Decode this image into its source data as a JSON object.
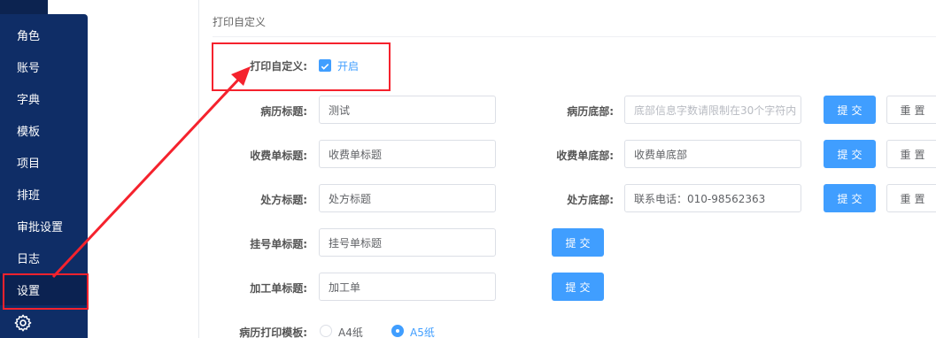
{
  "sidebar": {
    "items": [
      {
        "label": "角色"
      },
      {
        "label": "账号"
      },
      {
        "label": "字典"
      },
      {
        "label": "模板"
      },
      {
        "label": "项目"
      },
      {
        "label": "排班"
      },
      {
        "label": "审批设置"
      },
      {
        "label": "日志"
      },
      {
        "label": "设置"
      }
    ],
    "active_index": 8,
    "gear_icon": "gear-icon"
  },
  "section": {
    "title": "打印自定义"
  },
  "print_custom": {
    "label": "打印自定义:",
    "checkbox_label": "开启",
    "checked": true
  },
  "form": {
    "record_title": {
      "label": "病历标题:",
      "value": "测试"
    },
    "record_footer": {
      "label": "病历底部:",
      "placeholder": "底部信息字数请限制在30个字符内"
    },
    "fee_title": {
      "label": "收费单标题:",
      "value": "收费单标题"
    },
    "fee_footer": {
      "label": "收费单底部:",
      "value": "收费单底部"
    },
    "rx_title": {
      "label": "处方标题:",
      "value": "处方标题"
    },
    "rx_footer": {
      "label": "处方底部:",
      "value": "联系电话：010-98562363"
    },
    "reg_title": {
      "label": "挂号单标题:",
      "value": "挂号单标题"
    },
    "proc_title": {
      "label": "加工单标题:",
      "value": "加工单"
    },
    "template": {
      "label": "病历打印模板:",
      "options": [
        "A4纸",
        "A5纸"
      ],
      "selected": "A5纸"
    }
  },
  "buttons": {
    "submit": "提交",
    "reset": "重置"
  },
  "colors": {
    "sidebar": "#0f2d66",
    "primary": "#409eff",
    "highlight": "#f5222d"
  }
}
